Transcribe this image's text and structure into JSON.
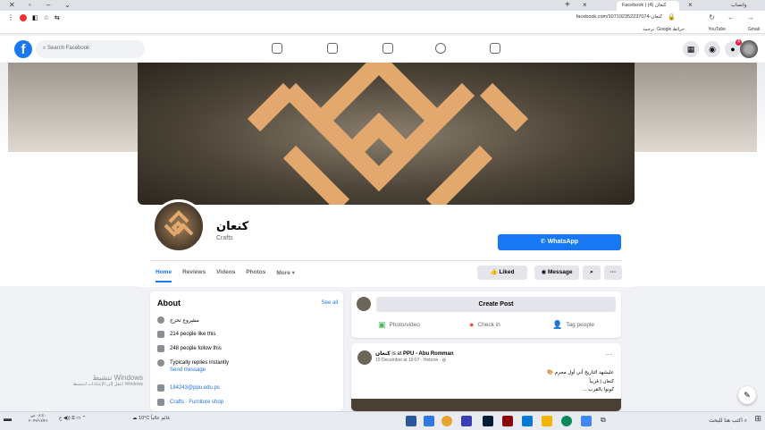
{
  "browser": {
    "tabs": [
      {
        "title": "Facebook | كنعان (4)"
      },
      {
        "title": "واتساب"
      }
    ],
    "url": "facebook.com/107192352237074-كنعان",
    "bookmarks": [
      "Gmail",
      "YouTube",
      "Google خرائط",
      "ترجمة"
    ]
  },
  "fb": {
    "search_placeholder": "Search Facebook",
    "notif_count": "4",
    "nav_icons": [
      "home-icon",
      "watch-icon",
      "marketplace-icon",
      "groups-icon",
      "gaming-icon"
    ]
  },
  "page": {
    "name": "كنعان",
    "category": "Crafts",
    "whatsapp_label": "WhatsApp",
    "tabs": [
      "Home",
      "Reviews",
      "Videos",
      "Photos",
      "More ▾"
    ],
    "liked_label": "Liked",
    "message_label": "Message",
    "more_label": "···",
    "cover_color": "#e2a86e"
  },
  "about": {
    "title": "About",
    "see_all": "See all",
    "rows": [
      {
        "icon": "info-icon",
        "text": "مشروع تخرج"
      },
      {
        "icon": "like-icon",
        "text": "214 people like this"
      },
      {
        "icon": "follow-icon",
        "text": "248 people follow this"
      },
      {
        "icon": "clock-icon",
        "text": "Typically replies instantly"
      },
      {
        "icon": "link",
        "text": "Send message"
      },
      {
        "icon": "email-icon",
        "text": "184243@ppu.edu.ps"
      },
      {
        "icon": "tag-icon",
        "text": "Crafts · Furniture shop"
      }
    ]
  },
  "create_post": {
    "title": "Create Post",
    "actions": [
      "Photo/video",
      "Check in",
      "Tag people"
    ]
  },
  "post": {
    "author": "كنعان",
    "location_prefix": " is at ",
    "location": "PPU - Abu Romman",
    "meta": "19 December at 19:07 · Hebron · ◍",
    "line1": "عليشهد التاريخ أني أول مجرم 🎨",
    "line2": "كنعان | قريباً",
    "line3": "كونوا بالقرب ..."
  },
  "windows": {
    "activate_title": "تنشيط Windows",
    "activate_sub": "انتقل إلى الإعدادات لتنشيط Windows",
    "weather": "10°C غائم عالياً",
    "search": "اكتب هنا للبحث",
    "clock_time": "٠٨:٤٠ ص",
    "clock_date": "٢٠٢٢/١٢/٢١"
  }
}
